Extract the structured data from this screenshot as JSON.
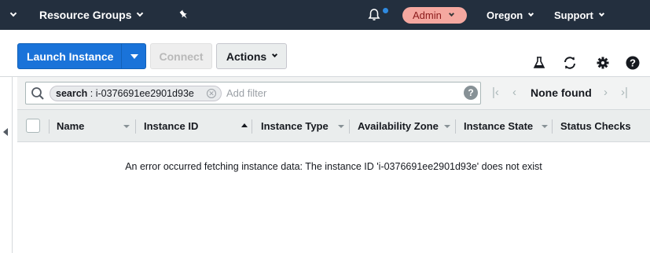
{
  "topbar": {
    "resource_groups": "Resource Groups",
    "account": "Admin",
    "region": "Oregon",
    "support": "Support"
  },
  "toolbar": {
    "launch_label": "Launch Instance",
    "connect_label": "Connect",
    "actions_label": "Actions"
  },
  "filter": {
    "token_key": "search",
    "token_value": "i-0376691ee2901d93e",
    "placeholder": "Add filter",
    "pagination_status": "None found"
  },
  "table": {
    "columns": [
      "Name",
      "Instance ID",
      "Instance Type",
      "Availability Zone",
      "Instance State",
      "Status Checks"
    ]
  },
  "message": "An error occurred fetching instance data: The instance ID 'i-0376691ee2901d93e' does not exist",
  "colors": {
    "topbar_bg": "#232f3e",
    "primary_button": "#1a73d9",
    "admin_badge": "#f5a8a0",
    "notification_dot": "#2f8ae0"
  }
}
